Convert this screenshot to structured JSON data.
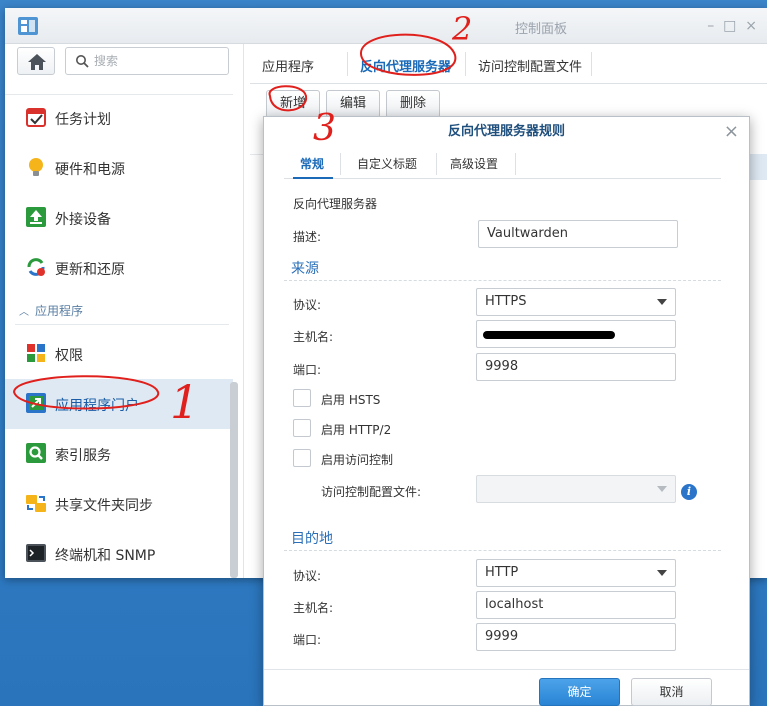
{
  "window": {
    "title": "控制面板"
  },
  "sidebar": {
    "search_placeholder": "搜索",
    "items": [
      {
        "label": "任务计划",
        "icon": "calendar-check-icon"
      },
      {
        "label": "硬件和电源",
        "icon": "lightbulb-icon"
      },
      {
        "label": "外接设备",
        "icon": "upload-drive-icon"
      },
      {
        "label": "更新和还原",
        "icon": "refresh-icon"
      },
      {
        "label": "权限",
        "icon": "permissions-icon"
      },
      {
        "label": "应用程序门户",
        "icon": "app-portal-icon"
      },
      {
        "label": "索引服务",
        "icon": "index-search-icon"
      },
      {
        "label": "共享文件夹同步",
        "icon": "folder-sync-icon"
      },
      {
        "label": "终端机和 SNMP",
        "icon": "terminal-icon"
      }
    ],
    "section_label": "应用程序",
    "active_item": "应用程序门户"
  },
  "main": {
    "tabs": [
      "应用程序",
      "反向代理服务器",
      "访问控制配置文件"
    ],
    "active_tab": "反向代理服务器",
    "toolbar": {
      "create": "新增",
      "edit": "编辑",
      "delete": "删除"
    }
  },
  "dialog": {
    "title": "反向代理服务器规则",
    "tabs": [
      "常规",
      "自定义标题",
      "高级设置"
    ],
    "active_tab": "常规",
    "group_label": "反向代理服务器",
    "description_label": "描述:",
    "description_value": "Vaultwarden",
    "source": {
      "title": "来源",
      "protocol_label": "协议:",
      "protocol_value": "HTTPS",
      "hostname_label": "主机名:",
      "port_label": "端口:",
      "port_value": "9998",
      "hsts_label": "启用 HSTS",
      "http2_label": "启用 HTTP/2",
      "access_control_label": "启用访问控制",
      "access_profile_label": "访问控制配置文件:"
    },
    "destination": {
      "title": "目的地",
      "protocol_label": "协议:",
      "protocol_value": "HTTP",
      "hostname_label": "主机名:",
      "hostname_value": "localhost",
      "port_label": "端口:",
      "port_value": "9999"
    },
    "ok_label": "确定",
    "cancel_label": "取消"
  },
  "annotations": {
    "mark1": "1",
    "mark2": "2",
    "mark3": "3"
  },
  "colors": {
    "accent": "#1a6ab8",
    "desktop": "#2f7cc4",
    "annotation": "#e0201c",
    "ok_button": "#2a84d4"
  }
}
